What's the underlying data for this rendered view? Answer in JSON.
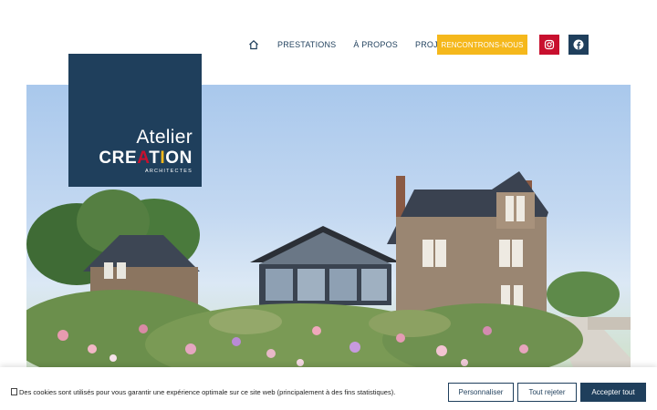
{
  "nav": {
    "items": [
      {
        "label": "PRESTATIONS"
      },
      {
        "label": "À PROPOS"
      },
      {
        "label": "PROJETS"
      }
    ],
    "cta_label": "RENCONTRONS-NOUS"
  },
  "logo": {
    "line1": "Atelier",
    "line2_a": "CRE",
    "line2_b": "A",
    "line2_c": "T",
    "line2_d": "I",
    "line2_e": "ON",
    "line3": "ARCHITECTES"
  },
  "cookie": {
    "text": "Des cookies sont utilisés pour vous garantir une expérience optimale sur ce site web (principalement à des fins statistiques).",
    "personalize_label": "Personnaliser",
    "reject_label": "Tout rejeter",
    "accept_label": "Accepter tout"
  },
  "colors": {
    "brand_navy": "#1f3f5c",
    "brand_yellow": "#f5b81c",
    "brand_red": "#c8102e"
  }
}
